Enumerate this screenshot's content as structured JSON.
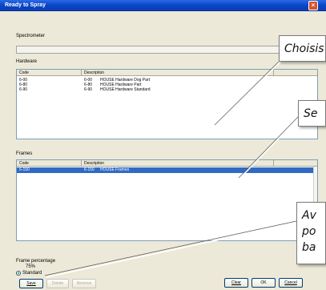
{
  "window": {
    "title": "Ready to Spray",
    "close_glyph": "×"
  },
  "sections": {
    "spectrometer_label": "Spectrometer",
    "hardware_label": "Hardware",
    "frames_label": "Frames"
  },
  "spectrometer": {
    "value": ""
  },
  "hardware_table": {
    "columns": [
      "Code",
      "Description"
    ],
    "rows": [
      {
        "code": "6-00",
        "num": "6-00",
        "description": "HOUSE Hardware Dog Part"
      },
      {
        "code": "6-80",
        "num": "6-80",
        "description": "HOUSE Hardware Part"
      },
      {
        "code": "6-90",
        "num": "6-90",
        "description": "HOUSE Hardware Standard"
      }
    ]
  },
  "frames_table": {
    "columns": [
      "Code",
      "Description"
    ],
    "rows": [
      {
        "code": "6-150",
        "num": "6-150",
        "description": "HOUSE Frames",
        "selected": true
      }
    ]
  },
  "frame_percentage": {
    "label": "Frame percentage",
    "value": "75%"
  },
  "options": {
    "standard_label": "Standard"
  },
  "buttons": {
    "save": "Save",
    "delete": "Delete",
    "remove": "Remove",
    "clear": "Clear",
    "ok": "OK",
    "cancel": "Cancel"
  },
  "callouts": {
    "c1": "Choisis",
    "c2": "Se",
    "c3_line1": "Av",
    "c3_line2": "po",
    "c3_line3": "ba"
  },
  "colors": {
    "titlebar": "#0a46c8",
    "selection": "#316ac5",
    "dialog_bg": "#ece9d8"
  }
}
